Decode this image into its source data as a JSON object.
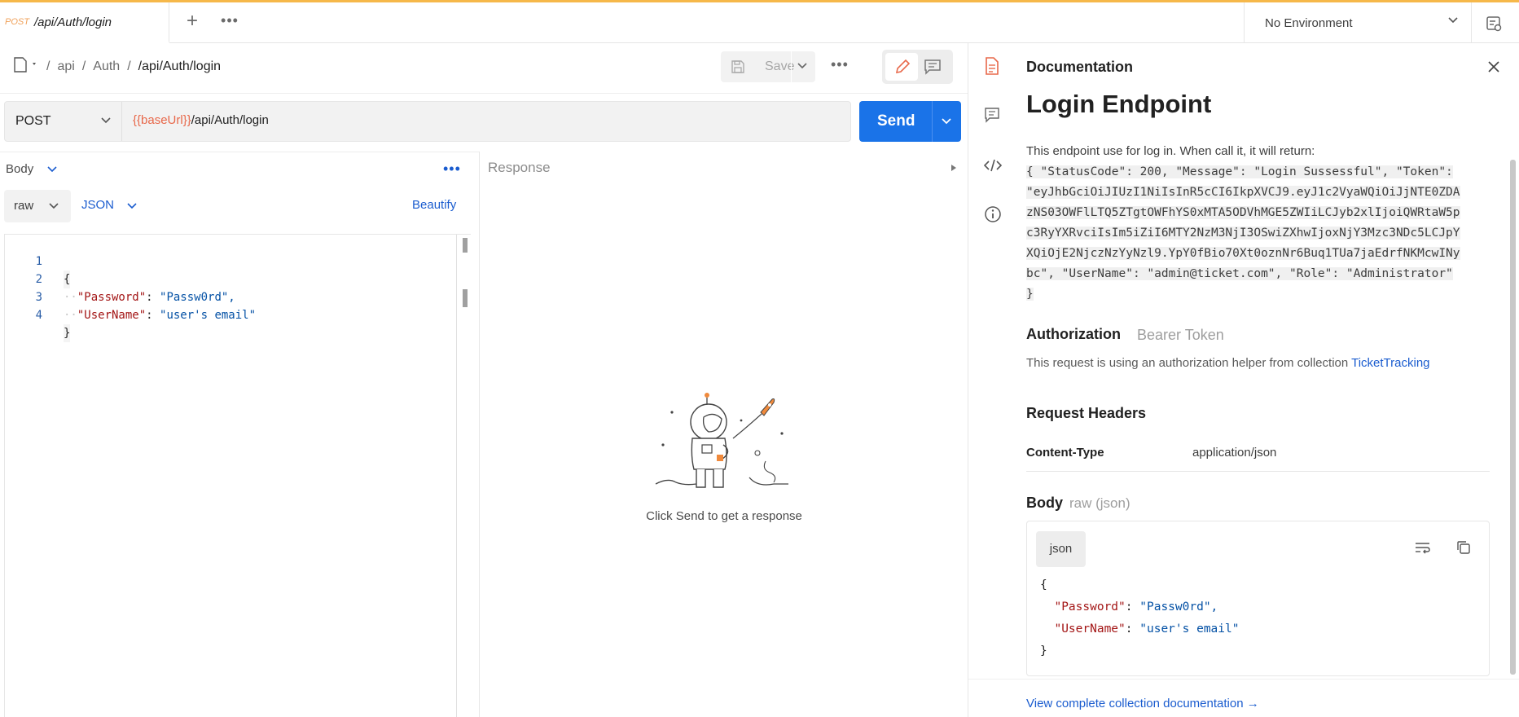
{
  "tab": {
    "method": "POST",
    "title": "/api/Auth/login",
    "add": "+",
    "more": "•••"
  },
  "environment": {
    "label": "No Environment"
  },
  "breadcrumb": {
    "items": [
      "api",
      "Auth"
    ],
    "current": "/api/Auth/login",
    "separator": "/"
  },
  "toolbar": {
    "save_label": "Save",
    "more": "•••"
  },
  "request": {
    "method": "POST",
    "url_var": "{{baseUrl}}",
    "url_path": "/api/Auth/login",
    "send_label": "Send"
  },
  "body": {
    "tab_label": "Body",
    "more": "•••",
    "mode": "raw",
    "language": "JSON",
    "beautify": "Beautify",
    "lines": [
      {
        "num": "1",
        "text": "{"
      },
      {
        "num": "2",
        "key": "\"Password\"",
        "value": "\"Passw0rd\","
      },
      {
        "num": "3",
        "key": "\"UserName\"",
        "value": "\"user's email\""
      },
      {
        "num": "4",
        "text": "}"
      }
    ]
  },
  "response": {
    "title": "Response",
    "hint": "Click Send to get a response"
  },
  "docs": {
    "header": "Documentation",
    "title": "Login Endpoint",
    "description": "This endpoint use for log in. When call it, it will return:",
    "code_lines": [
      "{ \"StatusCode\": 200, \"Message\": \"Login Sussessful\", \"Token\":",
      "\"eyJhbGciOiJIUzI1NiIsInR5cCI6IkpXVCJ9.eyJ1c2VyaWQiOiJjNTE0ZDA",
      "zNS03OWFlLTQ5ZTgtOWFhYS0xMTA5ODVhMGE5ZWIiLCJyb2xlIjoiQWRtaW5p",
      "c3RyYXRvciIsIm5iZiI6MTY2NzM3NjI3OSwiZXhwIjoxNjY3Mzc3NDc5LCJpY",
      "XQiOjE2NjczNzYyNzl9.YpY0fBio70Xt0oznNr6Buq1TUa7jaEdrfNKMcwINy",
      "bc\", \"UserName\": \"admin@ticket.com\", \"Role\": \"Administrator\"",
      "}"
    ],
    "auth_label": "Authorization",
    "auth_type": "Bearer Token",
    "auth_note": "This request is using an authorization helper from collection ",
    "auth_collection": "TicketTracking",
    "headers_title": "Request Headers",
    "header_key": "Content-Type",
    "header_value": "application/json",
    "body_title": "Body",
    "body_type": "raw (json)",
    "json_tag": "json",
    "body_lines": [
      {
        "text": "{"
      },
      {
        "key": "\"Password\"",
        "value": "\"Passw0rd\","
      },
      {
        "key": "\"UserName\"",
        "value": "\"user's email\""
      },
      {
        "text": "}"
      }
    ],
    "view_all": "View complete collection documentation →"
  },
  "colors": {
    "accent_blue": "#1a73e8",
    "link_blue": "#1a5ccf",
    "var_orange": "#e8684a",
    "tab_underline": "#f6b84a"
  },
  "icons": [
    "file-icon",
    "add-icon",
    "more-icon",
    "chevron-down-icon",
    "environment-icon",
    "save-icon",
    "pencil-icon",
    "comment-icon",
    "documentation-icon",
    "code-icon",
    "info-icon",
    "close-icon",
    "wrap-icon",
    "copy-icon",
    "triangle-right-icon",
    "astronaut-illustration"
  ]
}
